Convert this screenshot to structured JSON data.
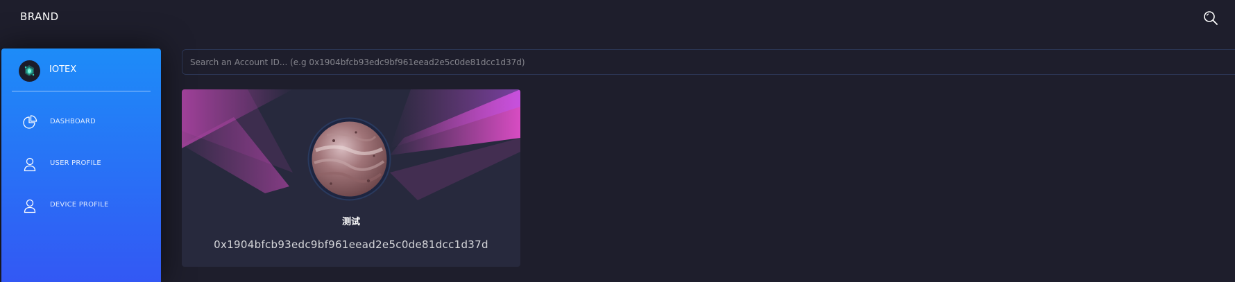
{
  "navbar": {
    "brand": "BRAND",
    "search_icon": "search-icon"
  },
  "sidebar": {
    "logo_icon": "iotex-logo-icon",
    "title": "IOTEX",
    "items": [
      {
        "label": "DASHBOARD",
        "icon": "pie-chart-icon"
      },
      {
        "label": "USER PROFILE",
        "icon": "user-icon"
      },
      {
        "label": "DEVICE PROFILE",
        "icon": "user-icon"
      }
    ]
  },
  "search": {
    "placeholder": "Search an Account ID... (e.g 0x1904bfcb93edc9bf961eead2e5c0de81dcc1d37d)",
    "value": ""
  },
  "profile_card": {
    "name": "测试",
    "address": "0x1904bfcb93edc9bf961eead2e5c0de81dcc1d37d",
    "avatar": "planet-avatar"
  },
  "colors": {
    "background": "#1e1e2c",
    "sidebar_top": "#1d8cf8",
    "sidebar_bottom": "#3358f4",
    "card": "#27293d",
    "accent_pink": "#e14eca"
  }
}
